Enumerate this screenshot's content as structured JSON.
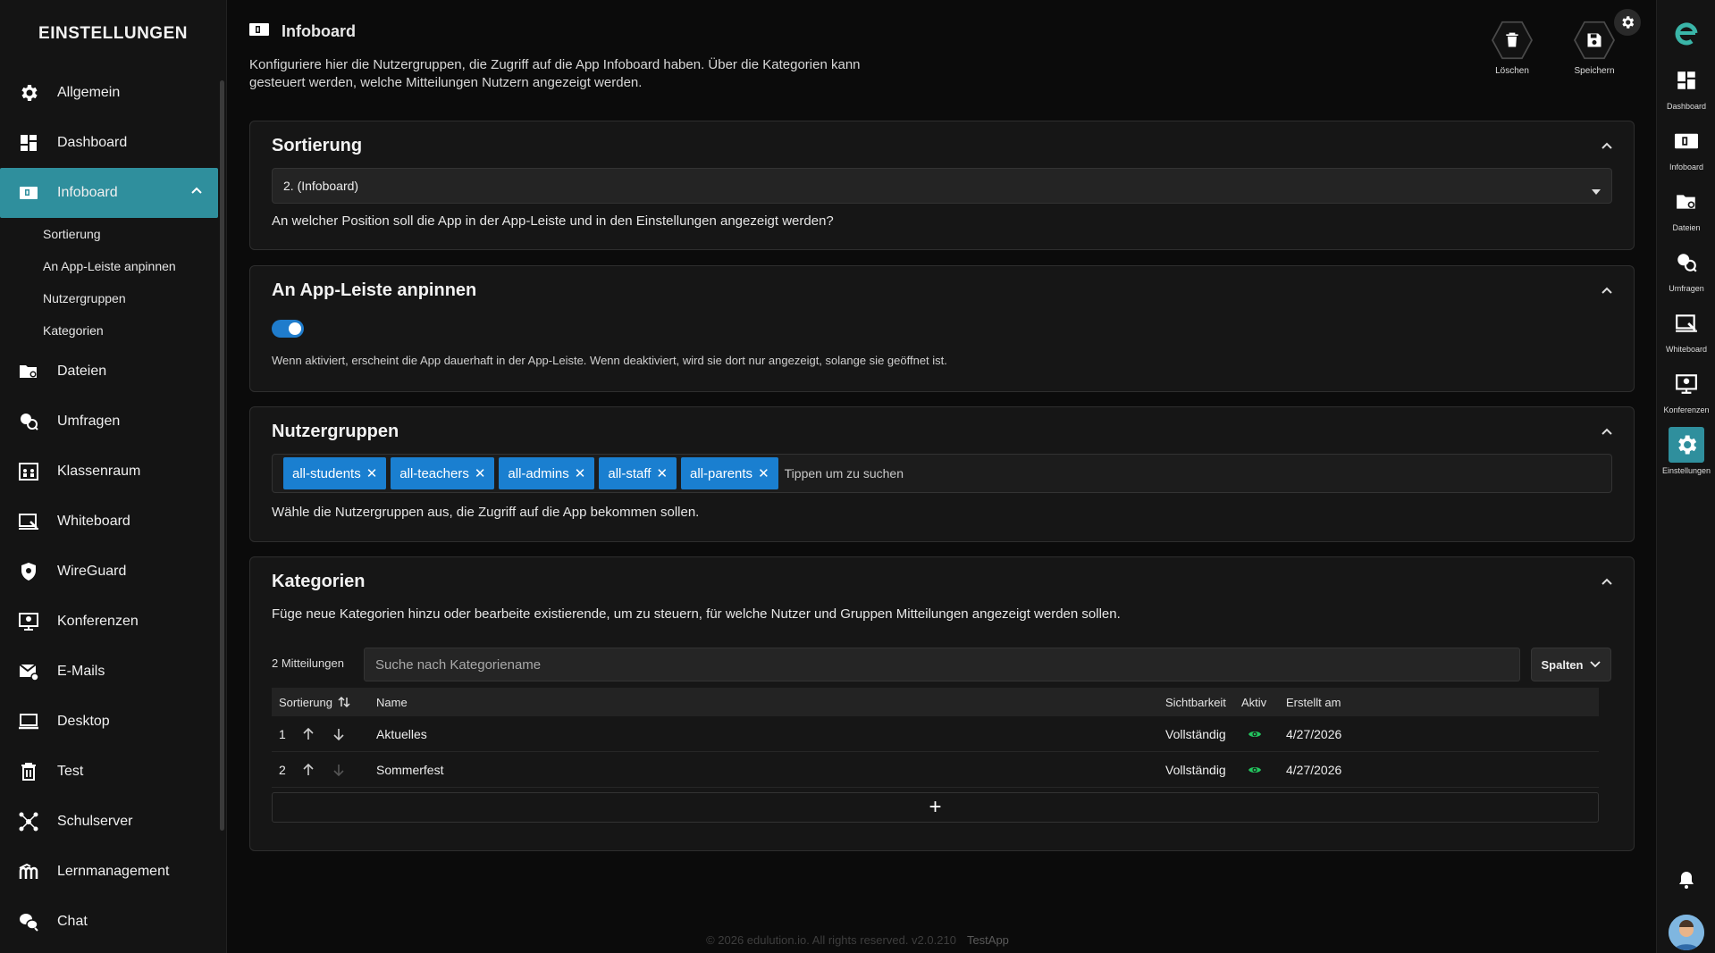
{
  "sidebar": {
    "title": "EINSTELLUNGEN",
    "items": [
      {
        "label": "Allgemein",
        "icon": "gear-icon"
      },
      {
        "label": "Dashboard",
        "icon": "dashboard-icon"
      },
      {
        "label": "Infoboard",
        "icon": "infoboard-icon"
      },
      {
        "label": "Dateien",
        "icon": "folder-icon"
      },
      {
        "label": "Umfragen",
        "icon": "survey-icon"
      },
      {
        "label": "Klassenraum",
        "icon": "classroom-icon"
      },
      {
        "label": "Whiteboard",
        "icon": "whiteboard-icon"
      },
      {
        "label": "WireGuard",
        "icon": "shield-icon"
      },
      {
        "label": "Konferenzen",
        "icon": "conference-icon"
      },
      {
        "label": "E-Mails",
        "icon": "mail-icon"
      },
      {
        "label": "Desktop",
        "icon": "desktop-icon"
      },
      {
        "label": "Test",
        "icon": "trash-icon"
      },
      {
        "label": "Schulserver",
        "icon": "network-icon"
      },
      {
        "label": "Lernmanagement",
        "icon": "moodle-icon"
      },
      {
        "label": "Chat",
        "icon": "chat-icon"
      }
    ],
    "subitems": [
      "Sortierung",
      "An App-Leiste anpinnen",
      "Nutzergruppen",
      "Kategorien"
    ]
  },
  "header": {
    "title": "Infoboard",
    "description": "Konfiguriere hier die Nutzergruppen, die Zugriff auf die App Infoboard haben. Über die Kategorien kann gesteuert werden, welche Mitteilungen Nutzern angezeigt werden.",
    "delete_label": "Löschen",
    "save_label": "Speichern"
  },
  "sort_card": {
    "title": "Sortierung",
    "selected": "2. (Infoboard)",
    "help": "An welcher Position soll die App in der App-Leiste und in den Einstellungen angezeigt werden?"
  },
  "pin_card": {
    "title": "An App-Leiste anpinnen",
    "enabled": true,
    "help": "Wenn aktiviert, erscheint die App dauerhaft in der App-Leiste. Wenn deaktiviert, wird sie dort nur angezeigt, solange sie geöffnet ist."
  },
  "groups_card": {
    "title": "Nutzergruppen",
    "tags": [
      "all-students",
      "all-teachers",
      "all-admins",
      "all-staff",
      "all-parents"
    ],
    "placeholder": "Tippen um zu suchen",
    "help": "Wähle die Nutzergruppen aus, die Zugriff auf die App bekommen sollen."
  },
  "categories_card": {
    "title": "Kategorien",
    "help": "Füge neue Kategorien hinzu oder bearbeite existierende, um zu steuern, für welche Nutzer und Gruppen Mitteilungen angezeigt werden sollen.",
    "count": "2 Mitteilungen",
    "search_placeholder": "Suche nach Kategoriename",
    "columns_button": "Spalten",
    "headers": {
      "sort": "Sortierung",
      "name": "Name",
      "visibility": "Sichtbarkeit",
      "active": "Aktiv",
      "created": "Erstellt am"
    },
    "rows": [
      {
        "sort": "1",
        "name": "Aktuelles",
        "visibility": "Vollständig",
        "created": "4/27/2026"
      },
      {
        "sort": "2",
        "name": "Sommerfest",
        "visibility": "Vollständig",
        "created": "4/27/2026"
      }
    ],
    "add_symbol": "+"
  },
  "footer": {
    "text": "© 2026 edulution.io. All rights reserved. v2.0.210",
    "app": "TestApp"
  },
  "rail": {
    "items": [
      "Dashboard",
      "Infoboard",
      "Dateien",
      "Umfragen",
      "Whiteboard",
      "Konferenzen",
      "Einstellungen"
    ]
  },
  "colors": {
    "accent": "#2f8f9d",
    "tag": "#1a7fd0",
    "active_eye": "#22c55e",
    "brand": "#3ab5a8"
  }
}
